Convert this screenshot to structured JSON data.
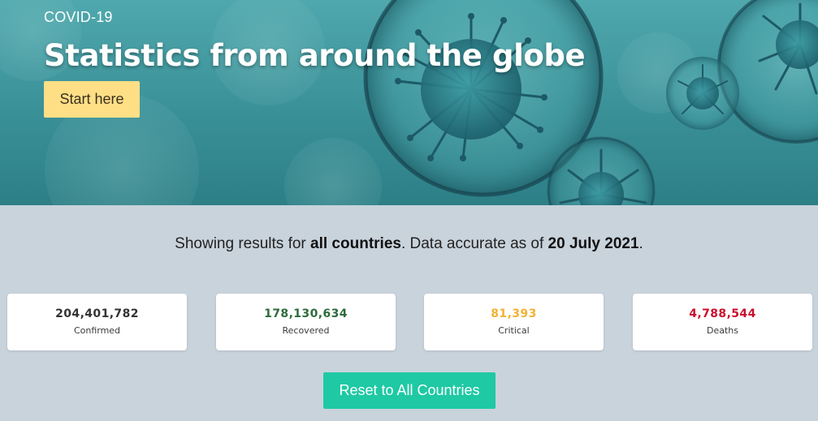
{
  "hero": {
    "eyebrow": "COVID-19",
    "title": "Statistics from around the globe",
    "start_button": "Start here"
  },
  "summary": {
    "prefix": "Showing results for ",
    "scope": "all countries",
    "middle": ". Data accurate as of ",
    "date": "20 July 2021",
    "suffix": "."
  },
  "stats": [
    {
      "value": "204,401,782",
      "label": "Confirmed",
      "color": "#333333"
    },
    {
      "value": "178,130,634",
      "label": "Recovered",
      "color": "#2e6b3c"
    },
    {
      "value": "81,393",
      "label": "Critical",
      "color": "#f2b234"
    },
    {
      "value": "4,788,544",
      "label": "Deaths",
      "color": "#c8102e"
    }
  ],
  "reset_button": "Reset to All Countries",
  "colors": {
    "hero_bg": "#3a9097",
    "page_bg": "#c9d3dc",
    "start_button_bg": "#ffdf85",
    "reset_button_bg": "#1ec9a4"
  }
}
